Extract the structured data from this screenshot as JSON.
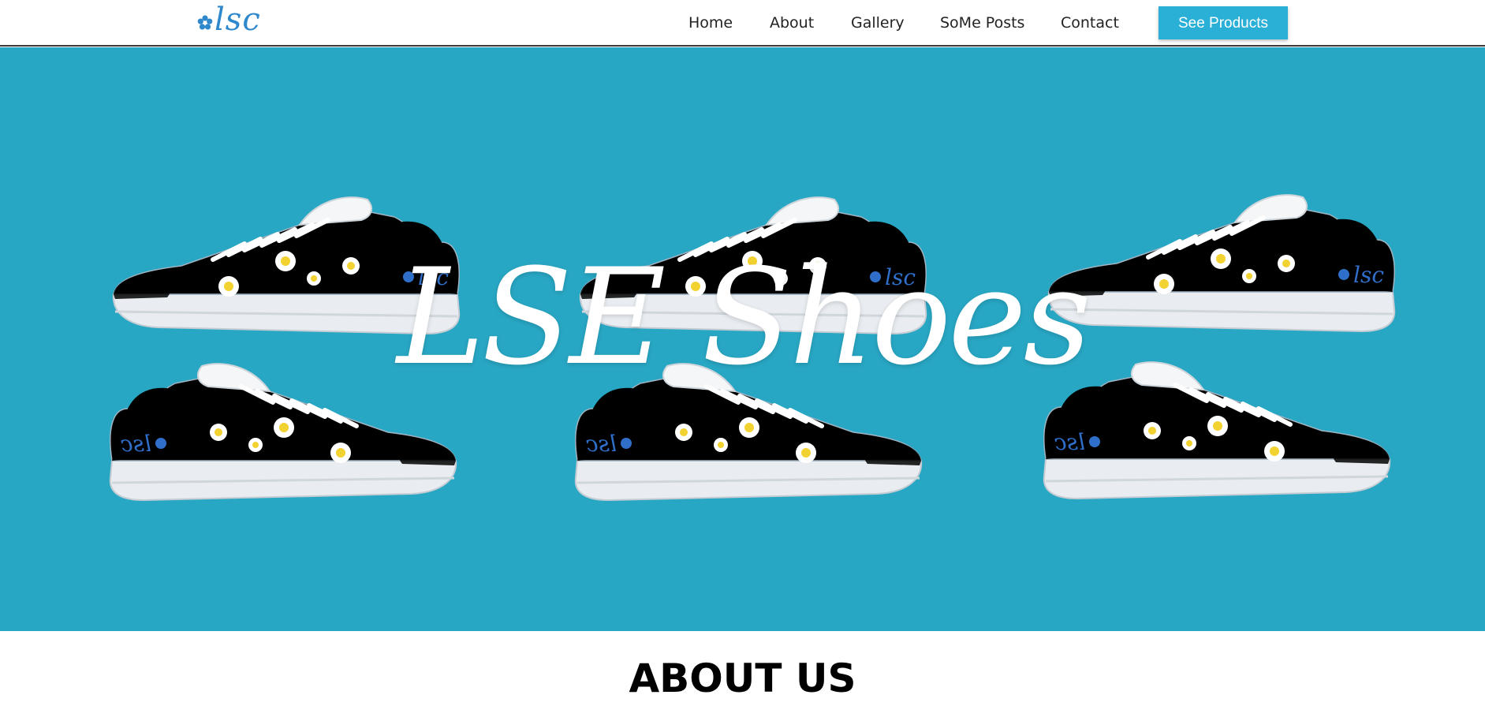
{
  "brand": {
    "logo_text": "lsc",
    "logo_icon": "flower-icon",
    "colors": {
      "accent": "#2aafd6",
      "hero_bg": "#28a7c4",
      "logo": "#2f88cc"
    }
  },
  "nav": {
    "items": [
      {
        "label": "Home"
      },
      {
        "label": "About"
      },
      {
        "label": "Gallery"
      },
      {
        "label": "SoMe Posts"
      },
      {
        "label": "Contact"
      }
    ],
    "cta_label": "See Products"
  },
  "hero": {
    "title": "LSE Shoes",
    "shoe_colors": [
      "#a9d3ee",
      "#8fd3a8",
      "#dbe77a"
    ]
  },
  "about": {
    "title": "ABOUT US"
  }
}
